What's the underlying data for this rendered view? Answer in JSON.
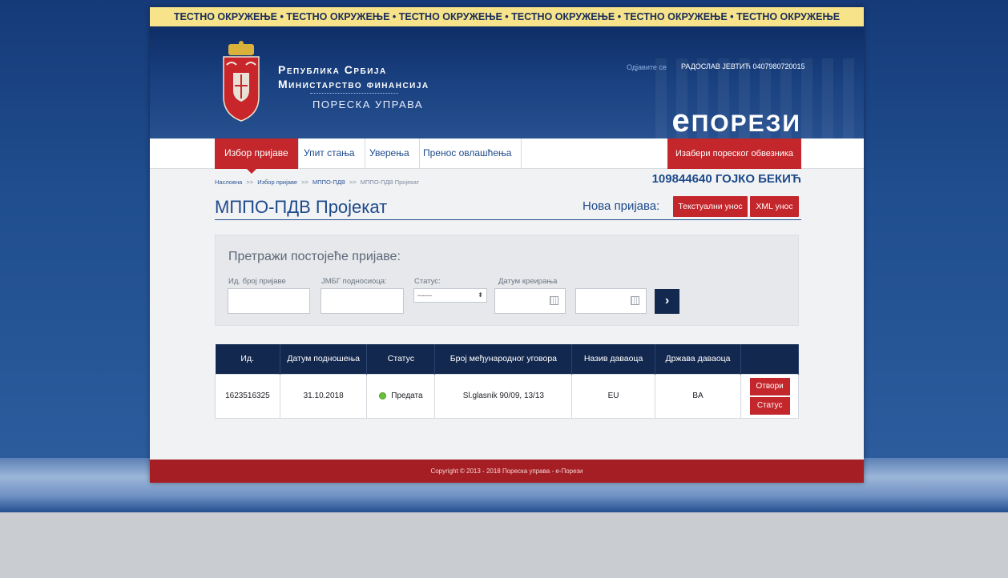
{
  "banner": {
    "text": "ТЕСТНО ОКРУЖЕЊЕ  •  ТЕСТНО ОКРУЖЕЊЕ  •  ТЕСТНО ОКРУЖЕЊЕ  •  ТЕСТНО ОКРУЖЕЊЕ  •  ТЕСТНО ОКРУЖЕЊЕ  •  ТЕСТНО ОКРУЖЕЊЕ"
  },
  "header": {
    "line1": "Република Србија",
    "line2": "Министарство финансија",
    "line3": "ПОРЕСКА УПРАВА",
    "logout": "Одјавите се",
    "user": "РАДОСЛАВ ЈЕВТИЋ 0407980720015",
    "brand_e": "е",
    "brand_rest": "ПОРЕЗИ"
  },
  "nav": {
    "items": [
      {
        "label": "Избор пријаве",
        "active": true
      },
      {
        "label": "Упит стања"
      },
      {
        "label": "Уверења"
      },
      {
        "label": "Пренос овлашћења"
      }
    ],
    "right_button": "Изабери пореског обвезника"
  },
  "breadcrumb": {
    "home": "Насловна",
    "step1": "Избор пријаве",
    "step2": "МППО-ПДВ",
    "current": "МППО-ПДВ Пројекат",
    "sep": ">>"
  },
  "taxpayer": "109844640 ГОЈКО БЕКИЋ",
  "page": {
    "title": "МППО-ПДВ Пројекат",
    "new_report_label": "Нова пријава:",
    "text_entry_button": "Текстуални унос",
    "xml_entry_button": "XML унос"
  },
  "search": {
    "title": "Претражи постојеће пријаве:",
    "id_label": "Ид. број пријаве",
    "jmbg_label": "ЈМБГ подносиоца:",
    "status_label": "Статус:",
    "status_value": "------",
    "date_label": "Датум креирања",
    "go": "›"
  },
  "table": {
    "headers": [
      "Ид.",
      "Датум подношења",
      "Статус",
      "Број међународног уговора",
      "Назив даваоца",
      "Држава даваоца",
      ""
    ],
    "rows": [
      {
        "id": "1623516325",
        "date": "31.10.2018",
        "status": "Предата",
        "contract": "Sl.glasnik 90/09, 13/13",
        "donor": "EU",
        "country": "BA",
        "open_button": "Отвори",
        "status_button": "Статус"
      }
    ]
  },
  "footer": {
    "text": "Copyright © 2013 - 2018 Пореска управа - е-Порези"
  },
  "colors": {
    "accent_red": "#c3262b",
    "navy": "#13284f",
    "brand_blue": "#1d4a8a",
    "banner_yellow": "#f6e38a"
  }
}
